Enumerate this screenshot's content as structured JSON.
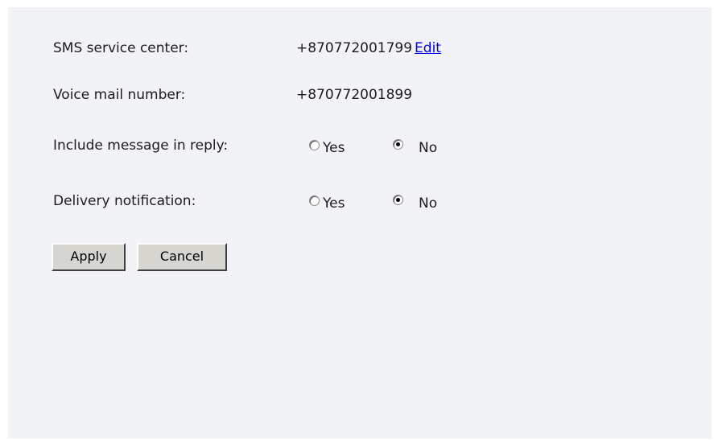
{
  "sms": {
    "label": "SMS service center:",
    "value": "+870772001799",
    "edit_label": "Edit"
  },
  "voicemail": {
    "label": "Voice mail number:",
    "value": "+870772001899"
  },
  "include_message": {
    "label": "Include message in reply:",
    "options": [
      "Yes",
      "No"
    ],
    "selected": "No"
  },
  "delivery": {
    "label": "Delivery notification:",
    "options": [
      "Yes",
      "No"
    ],
    "selected": "No"
  },
  "buttons": {
    "apply_label": "Apply",
    "cancel_label": "Cancel"
  }
}
